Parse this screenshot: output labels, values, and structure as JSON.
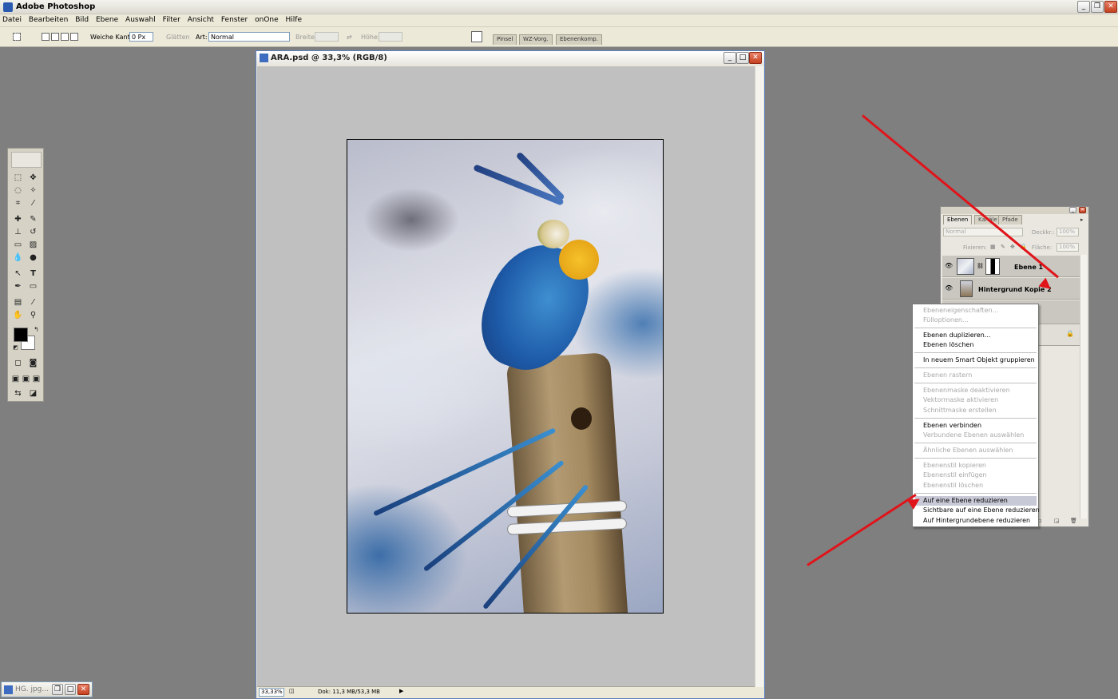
{
  "app": {
    "title": "Adobe Photoshop"
  },
  "menu": [
    "Datei",
    "Bearbeiten",
    "Bild",
    "Ebene",
    "Auswahl",
    "Filter",
    "Ansicht",
    "Fenster",
    "onOne",
    "Hilfe"
  ],
  "options": {
    "feather_label": "Weiche Kante:",
    "feather_value": "0 Px",
    "antialias_label": "Glätten",
    "style_label": "Art:",
    "style_value": "Normal",
    "width_label": "Breite:",
    "height_label": "Höhe:",
    "dock_tabs": [
      "Pinsel",
      "WZ-Vorg.",
      "Ebenenkomp."
    ]
  },
  "document": {
    "title": "ARA.psd @ 33,3% (RGB/8)",
    "zoom": "33,33%",
    "doc_info": "Dok: 11,3 MB/53,3 MB"
  },
  "minimized": {
    "title": "HG. jpg..."
  },
  "layers_panel": {
    "tabs": [
      "Ebenen",
      "Kanäle",
      "Pfade"
    ],
    "blend_mode": "Normal",
    "opacity_label": "Deckkr.:",
    "opacity_value": "100%",
    "lock_label": "Fixieren:",
    "fill_label": "Fläche:",
    "fill_value": "100%",
    "layers": [
      {
        "name": "Ebene 1"
      },
      {
        "name": "Hintergrund Kopie 2"
      }
    ]
  },
  "context_menu": {
    "items": [
      {
        "label": "Ebeneneigenschaften...",
        "enabled": false
      },
      {
        "label": "Fülloptionen...",
        "enabled": false
      },
      {
        "label": "Ebenen duplizieren...",
        "enabled": true
      },
      {
        "label": "Ebenen löschen",
        "enabled": true
      },
      {
        "label": "In neuem Smart Objekt gruppieren",
        "enabled": true
      },
      {
        "label": "Ebenen rastern",
        "enabled": false
      },
      {
        "label": "Ebenenmaske deaktivieren",
        "enabled": false
      },
      {
        "label": "Vektormaske aktivieren",
        "enabled": false
      },
      {
        "label": "Schnittmaske erstellen",
        "enabled": false
      },
      {
        "label": "Ebenen verbinden",
        "enabled": true
      },
      {
        "label": "Verbundene Ebenen auswählen",
        "enabled": false
      },
      {
        "label": "Ähnliche Ebenen auswählen",
        "enabled": false
      },
      {
        "label": "Ebenenstil kopieren",
        "enabled": false
      },
      {
        "label": "Ebenenstil einfügen",
        "enabled": false
      },
      {
        "label": "Ebenenstil löschen",
        "enabled": false
      },
      {
        "label": "Auf eine Ebene reduzieren",
        "enabled": true,
        "highlighted": true
      },
      {
        "label": "Sichtbare auf eine Ebene reduzieren",
        "enabled": true
      },
      {
        "label": "Auf Hintergrundebene reduzieren",
        "enabled": true
      }
    ]
  },
  "colors": {
    "annotation_arrow": "#e0141a",
    "workspace": "#7f7f7f"
  }
}
